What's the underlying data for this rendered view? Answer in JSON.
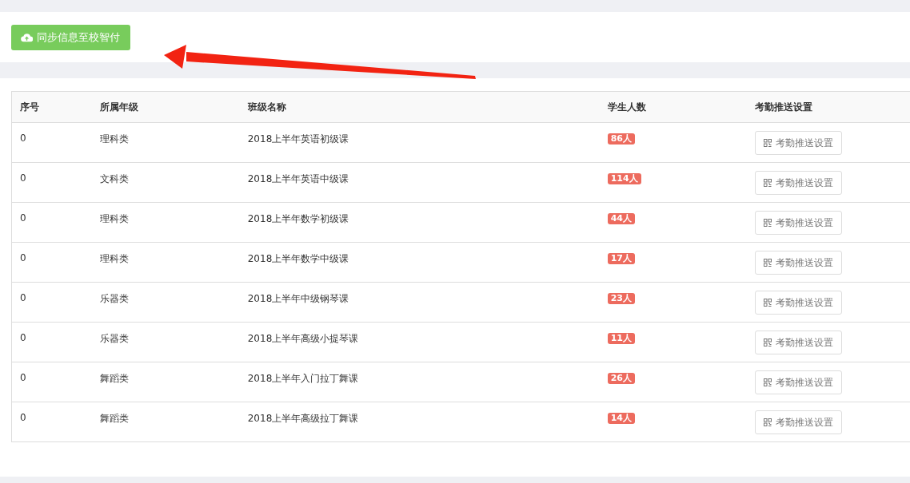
{
  "sync_button": {
    "label": "同步信息至校智付"
  },
  "table": {
    "columns": [
      "序号",
      "所属年级",
      "班级名称",
      "学生人数",
      "考勤推送设置"
    ],
    "rows": [
      {
        "index": "0",
        "grade": "理科类",
        "class_name": "2018上半年英语初级课",
        "students": "86人",
        "action": "考勤推送设置"
      },
      {
        "index": "0",
        "grade": "文科类",
        "class_name": "2018上半年英语中级课",
        "students": "114人",
        "action": "考勤推送设置"
      },
      {
        "index": "0",
        "grade": "理科类",
        "class_name": "2018上半年数学初级课",
        "students": "44人",
        "action": "考勤推送设置"
      },
      {
        "index": "0",
        "grade": "理科类",
        "class_name": "2018上半年数学中级课",
        "students": "17人",
        "action": "考勤推送设置"
      },
      {
        "index": "0",
        "grade": "乐器类",
        "class_name": "2018上半年中级钢琴课",
        "students": "23人",
        "action": "考勤推送设置"
      },
      {
        "index": "0",
        "grade": "乐器类",
        "class_name": "2018上半年高级小提琴课",
        "students": "11人",
        "action": "考勤推送设置"
      },
      {
        "index": "0",
        "grade": "舞蹈类",
        "class_name": "2018上半年入门拉丁舞课",
        "students": "26人",
        "action": "考勤推送设置"
      },
      {
        "index": "0",
        "grade": "舞蹈类",
        "class_name": "2018上半年高级拉丁舞课",
        "students": "14人",
        "action": "考勤推送设置"
      }
    ]
  }
}
